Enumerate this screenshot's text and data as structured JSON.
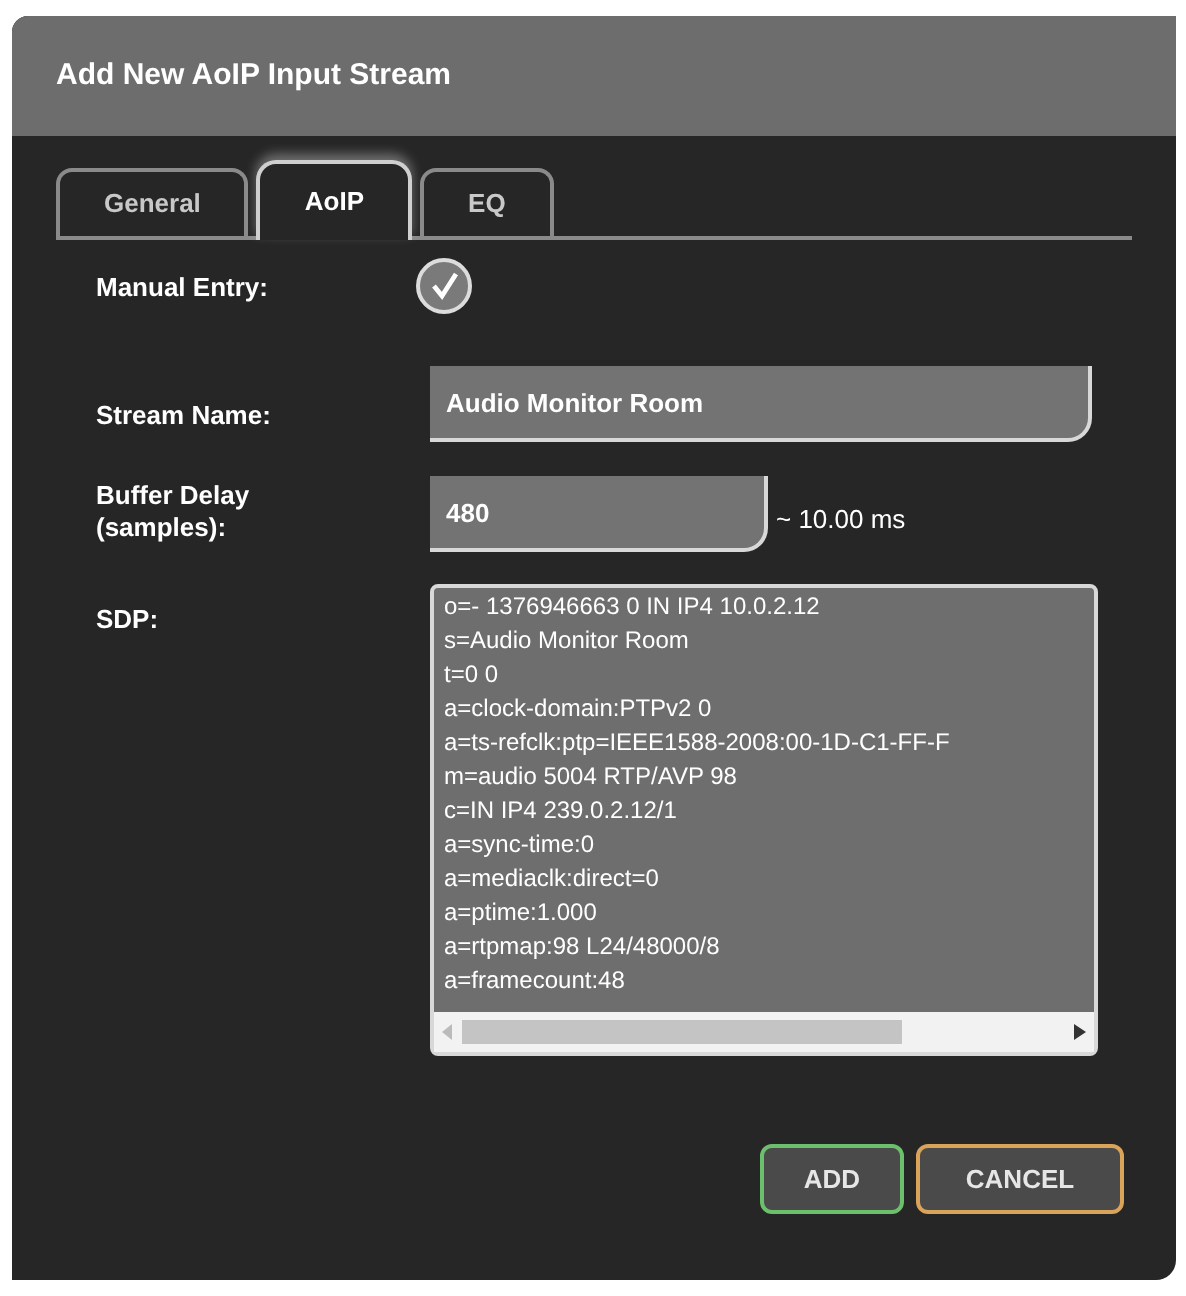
{
  "dialog": {
    "title": "Add New AoIP Input Stream"
  },
  "tabs": [
    {
      "label": "General",
      "selected": false
    },
    {
      "label": "AoIP",
      "selected": true
    },
    {
      "label": "EQ",
      "selected": false
    }
  ],
  "manual_entry": {
    "label": "Manual Entry:",
    "checked": true
  },
  "stream_name": {
    "label": "Stream Name:",
    "value": "Audio Monitor Room"
  },
  "buffer_delay": {
    "label": "Buffer Delay\n(samples):",
    "value": "480",
    "reading": "~ 10.00 ms"
  },
  "sdp": {
    "label": "SDP:",
    "lines": [
      "o=- 1376946663 0 IN IP4 10.0.2.12",
      "s=Audio Monitor Room",
      "t=0 0",
      "a=clock-domain:PTPv2 0",
      "a=ts-refclk:ptp=IEEE1588-2008:00-1D-C1-FF-F",
      "m=audio 5004 RTP/AVP 98",
      "c=IN IP4 239.0.2.12/1",
      "a=sync-time:0",
      "a=mediaclk:direct=0",
      "a=ptime:1.000",
      "a=rtpmap:98 L24/48000/8",
      "a=framecount:48"
    ]
  },
  "buttons": [
    {
      "label": "ADD",
      "kind": "confirm"
    },
    {
      "label": "CANCEL",
      "kind": "cancel"
    }
  ]
}
